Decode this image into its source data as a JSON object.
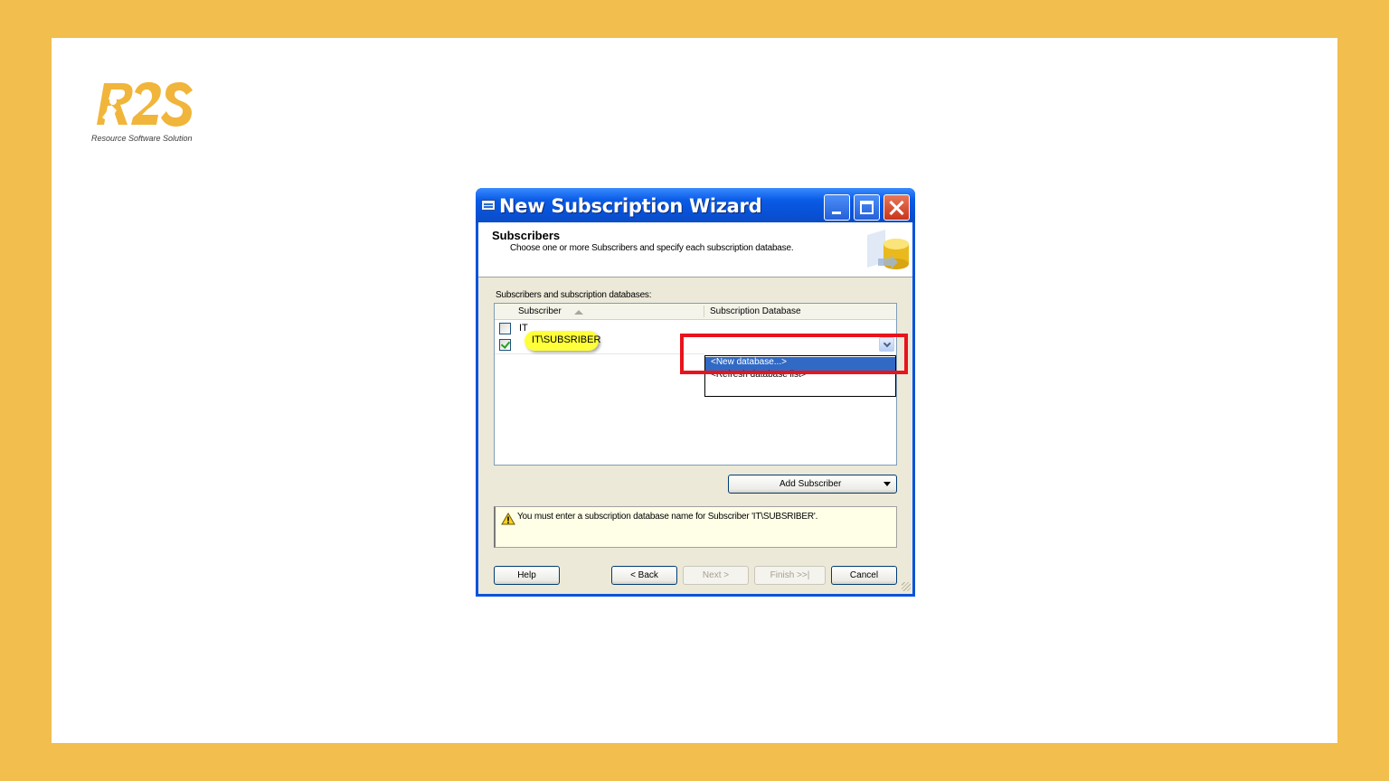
{
  "logo": {
    "mark_text": "R2S",
    "caption": "Resource Software Solution"
  },
  "window": {
    "title": "New Subscription Wizard",
    "header": {
      "title": "Subscribers",
      "subtitle": "Choose one or more Subscribers and specify each subscription database."
    },
    "list_label": "Subscribers and subscription databases:",
    "columns": [
      "Subscriber",
      "Subscription Database"
    ],
    "rows": [
      {
        "subscriber": "IT",
        "checked": false
      },
      {
        "subscriber": "IT\\SUBSRIBER",
        "checked": true
      }
    ],
    "dropdown_options": [
      "<New database...>",
      "<Refresh database list>"
    ],
    "add_subscriber_label": "Add Subscriber",
    "warning_message": "You must enter a subscription database name for Subscriber 'IT\\SUBSRIBER'.",
    "buttons": {
      "help": "Help",
      "back": "< Back",
      "next": "Next >",
      "finish": "Finish >>|",
      "cancel": "Cancel"
    }
  },
  "colors": {
    "frame": "#F2BE4E",
    "titlebar": "#0A53DC",
    "highlight": "#FFFF3A",
    "annotation_box": "#E8141C",
    "selected_option": "#316AC5"
  }
}
